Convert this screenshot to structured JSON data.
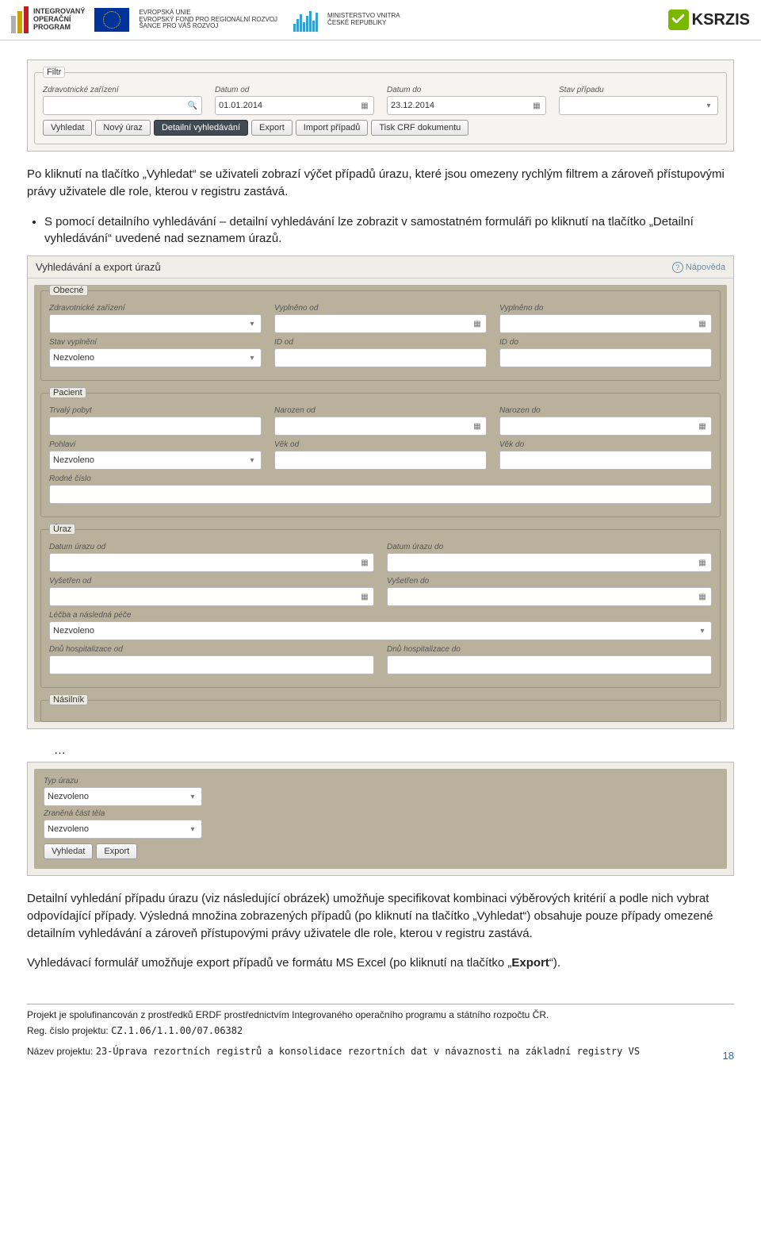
{
  "header": {
    "iop_lines": [
      "INTEGROVANÝ",
      "OPERAČNÍ",
      "PROGRAM"
    ],
    "eu_lines": [
      "EVROPSKÁ UNIE",
      "EVROPSKÝ FOND PRO REGIONÁLNÍ ROZVOJ",
      "ŠANCE PRO VÁŠ ROZVOJ"
    ],
    "min_lines": [
      "MINISTERSTVO VNITRA",
      "ČESKÉ REPUBLIKY"
    ],
    "ksr": "KSRZIS"
  },
  "shot1": {
    "legend": "Filtr",
    "cols": [
      {
        "label": "Zdravotnické zařízení",
        "value": "",
        "icon": "search-icon"
      },
      {
        "label": "Datum od",
        "value": "01.01.2014",
        "icon": "calendar-icon"
      },
      {
        "label": "Datum do",
        "value": "23.12.2014",
        "icon": "calendar-icon"
      },
      {
        "label": "Stav případu",
        "value": "",
        "icon": "chevron-down-icon"
      }
    ],
    "buttons": [
      "Vyhledat",
      "Nový úraz",
      "Detailní vyhledávání",
      "Export",
      "Import případů",
      "Tisk CRF dokumentu"
    ],
    "active_index": 2
  },
  "text1": "Po kliknutí na tlačítko „Vyhledat“ se uživateli zobrazí výčet případů úrazu, které jsou omezeny rychlým filtrem a zároveň přístupovými právy uživatele dle role, kterou v registru zastává.",
  "bullet1": "S pomocí detailního vyhledávání – detailní vyhledávání lze zobrazit v samostatném formuláři po kliknutí na tlačítko „Detailní vyhledávání“ uvedené nad seznamem úrazů.",
  "shot2": {
    "title": "Vyhledávání a export úrazů",
    "help": "Nápověda",
    "groups": [
      {
        "legend": "Obecné",
        "rows": [
          [
            {
              "label": "Zdravotnické zařízení",
              "icon": "chevron-down-icon"
            },
            {
              "label": "Vyplněno od",
              "icon": "calendar-icon"
            },
            {
              "label": "Vyplněno do",
              "icon": "calendar-icon"
            }
          ],
          [
            {
              "label": "Stav vyplnění",
              "value": "Nezvoleno",
              "icon": "chevron-down-icon"
            },
            {
              "label": "ID od"
            },
            {
              "label": "ID do"
            }
          ]
        ]
      },
      {
        "legend": "Pacient",
        "rows": [
          [
            {
              "label": "Trvalý pobyt"
            },
            {
              "label": "Narozen od",
              "icon": "calendar-icon"
            },
            {
              "label": "Narozen do",
              "icon": "calendar-icon"
            }
          ],
          [
            {
              "label": "Pohlaví",
              "value": "Nezvoleno",
              "icon": "chevron-down-icon"
            },
            {
              "label": "Věk od"
            },
            {
              "label": "Věk do"
            }
          ],
          [
            {
              "label": "Rodné číslo",
              "span": 3
            }
          ]
        ]
      },
      {
        "legend": "Úraz",
        "rows": [
          [
            {
              "label": "Datum úrazu od",
              "icon": "calendar-icon"
            },
            {
              "label": "Datum úrazu do",
              "icon": "calendar-icon"
            }
          ],
          [
            {
              "label": "Vyšetřen od",
              "icon": "calendar-icon"
            },
            {
              "label": "Vyšetřen do",
              "icon": "calendar-icon"
            }
          ],
          [
            {
              "label": "Léčba a následná péče",
              "value": "Nezvoleno",
              "icon": "chevron-down-icon",
              "span": 1
            }
          ],
          [
            {
              "label": "Dnů hospitalizace od"
            },
            {
              "label": "Dnů hospitalizace do"
            }
          ]
        ]
      },
      {
        "legend": "Násilník",
        "rows": []
      }
    ]
  },
  "ellipsis": "…",
  "shot3": {
    "rows": [
      [
        {
          "label": "Typ úrazu",
          "value": "Nezvoleno",
          "icon": "chevron-down-icon"
        }
      ],
      [
        {
          "label": "Zraněná část těla",
          "value": "Nezvoleno",
          "icon": "chevron-down-icon"
        }
      ]
    ],
    "buttons": [
      "Vyhledat",
      "Export"
    ]
  },
  "text2": "Detailní vyhledání případu úrazu (viz následující obrázek) umožňuje specifikovat kombinaci výběrových kritérií a podle nich vybrat odpovídající případy. Výsledná množina zobrazených případů (po kliknutí na tlačítko „Vyhledat“) obsahuje pouze případy omezené detailním vyhledávání a zároveň přístupovými právy uživatele dle role, kterou v registru zastává.",
  "text3_pre": "Vyhledávací formulář umožňuje export případů ve formátu MS Excel (po kliknutí na tlačítko „",
  "text3_bold": "Export",
  "text3_post": "“).",
  "footer": {
    "line1": "Projekt je spolufinancován z prostředků ERDF prostřednictvím Integrovaného operačního programu a státního rozpočtu ČR.",
    "reg_label": "Reg. číslo projektu: ",
    "reg_val": "CZ.1.06/1.1.00/07.06382",
    "name_label": "Název projektu: ",
    "name_val": "23-Úprava rezortních registrů a konsolidace rezortních dat v návaznosti na základní registry VS",
    "page": "18"
  }
}
